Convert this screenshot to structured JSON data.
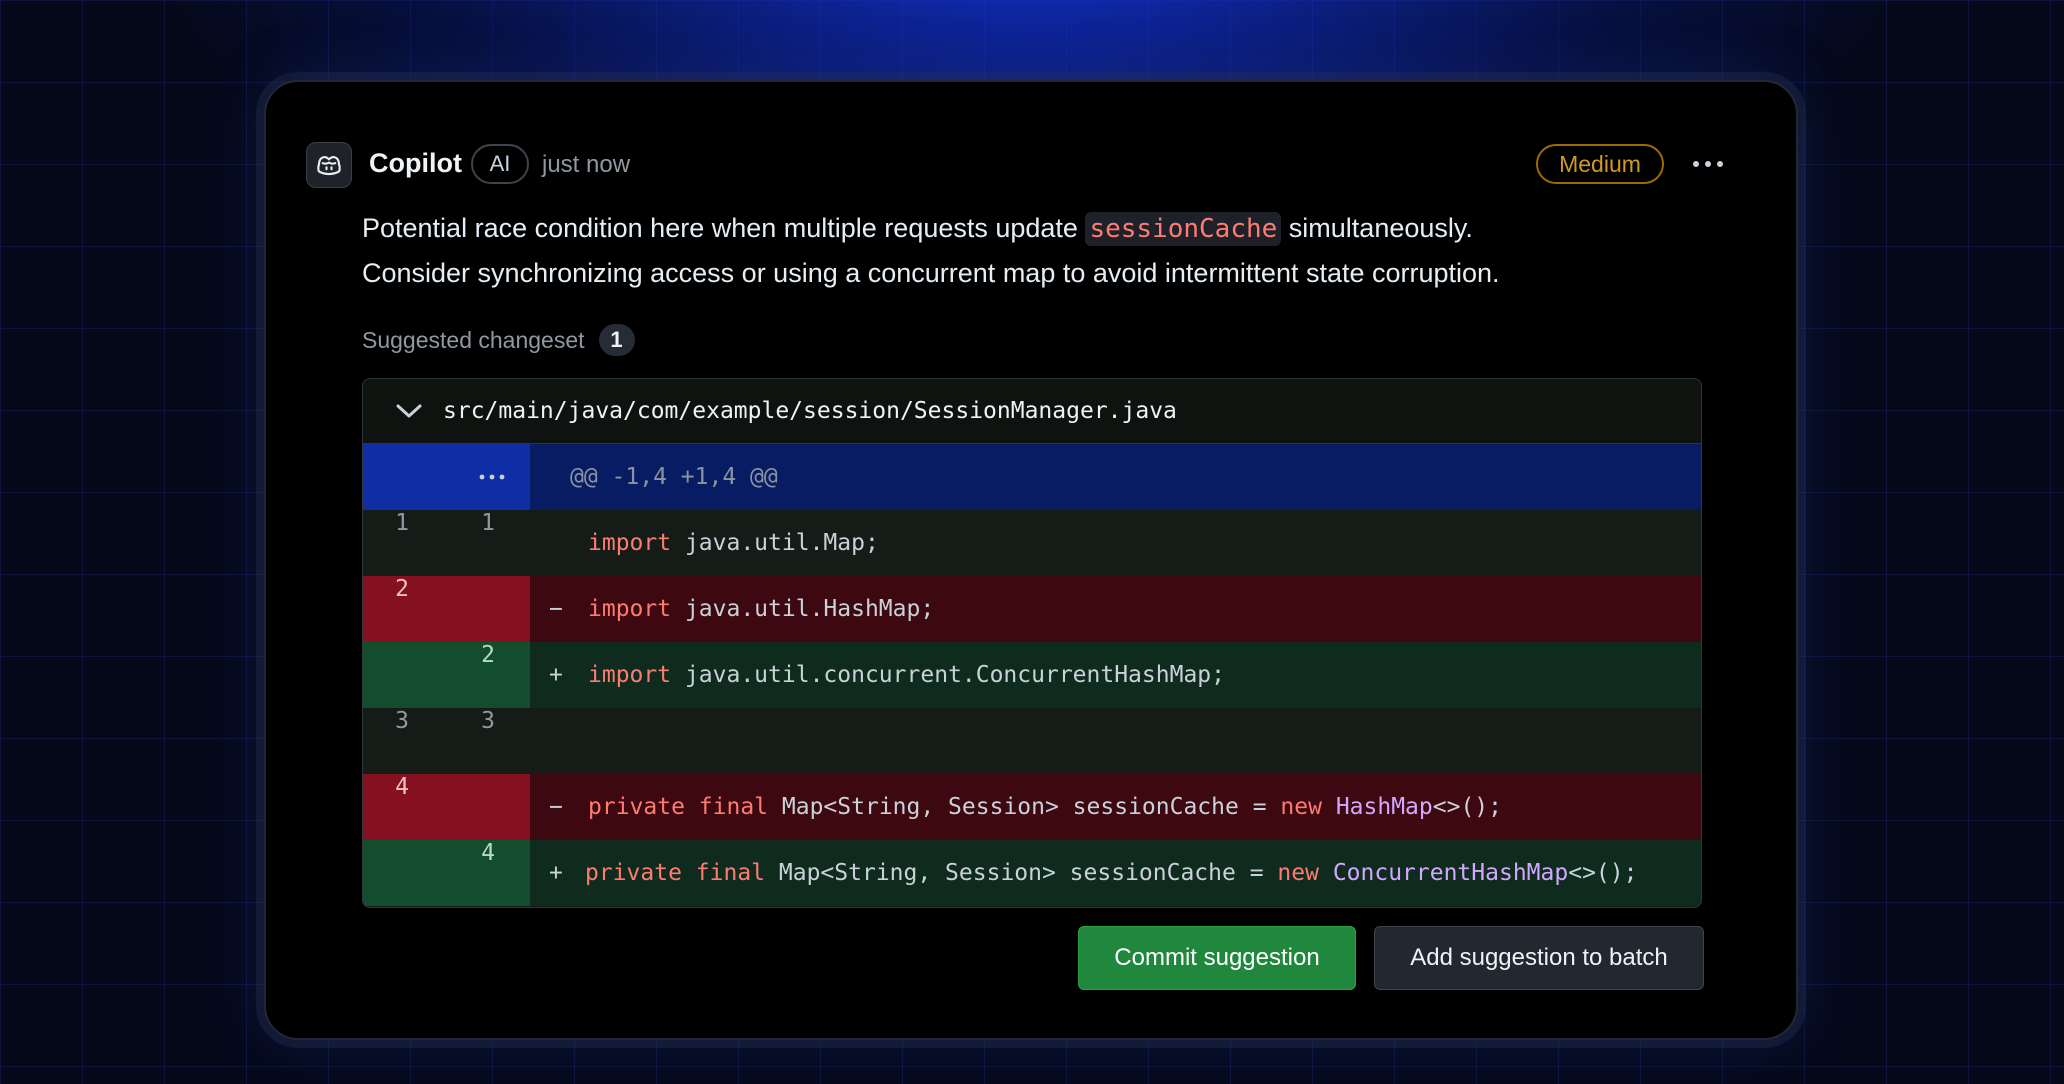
{
  "comment": {
    "author": "Copilot",
    "author_badge": "AI",
    "timestamp": "just now",
    "severity": "Medium",
    "body": {
      "line1_before": "Potential race condition here when multiple requests update ",
      "inline_code": "sessionCache",
      "line1_after": " simultaneously.",
      "line2": "Consider synchronizing access or using a concurrent map to avoid intermittent state corruption."
    },
    "changeset_label": "Suggested changeset",
    "changeset_count": "1"
  },
  "diff": {
    "file_path": "src/main/java/com/example/session/SessionManager.java",
    "hunk_header": "@@ -1,4 +1,4 @@",
    "rows": [
      {
        "type": "context",
        "old": "1",
        "new": "1",
        "marker": "",
        "kw": "import",
        "rest": " java.util.Map;"
      },
      {
        "type": "deletion",
        "old": "2",
        "new": "",
        "marker": "−",
        "kw": "import",
        "rest": " java.util.HashMap;"
      },
      {
        "type": "addition",
        "old": "",
        "new": "2",
        "marker": "+",
        "kw": "import",
        "rest": " java.util.concurrent.ConcurrentHashMap;"
      },
      {
        "type": "context",
        "old": "3",
        "new": "3",
        "marker": "",
        "kw": "",
        "rest": ""
      },
      {
        "type": "deletion",
        "old": "4",
        "new": "",
        "marker": "−",
        "kw1": "private",
        "kw2": "final",
        "mid": " Map<String, Session> sessionCache = ",
        "kw3": "new",
        "ty": "HashMap",
        "end": "<>();"
      },
      {
        "type": "addition",
        "old": "",
        "new": "4",
        "marker": "+",
        "kw1": "private",
        "kw2": "final",
        "mid": " Map<String, Session> sessionCache = ",
        "kw3": "new",
        "ty": "ConcurrentHashMap",
        "end": "<>();"
      }
    ]
  },
  "actions": {
    "commit_label": "Commit suggestion",
    "batch_label": "Add suggestion to batch"
  },
  "colors": {
    "commit_button": "#1f883d",
    "severity": "#d29922",
    "deletion_gutter": "#85101f",
    "addition_gutter": "#124d2e",
    "hunk_gutter": "#0f2ea6",
    "keyword": "#ff7b72",
    "type": "#d2a8ff"
  },
  "icons": {
    "avatar": "copilot-icon",
    "more": "kebab-horizontal-icon",
    "collapse": "chevron-down-icon",
    "expand": "ellipsis-icon"
  }
}
